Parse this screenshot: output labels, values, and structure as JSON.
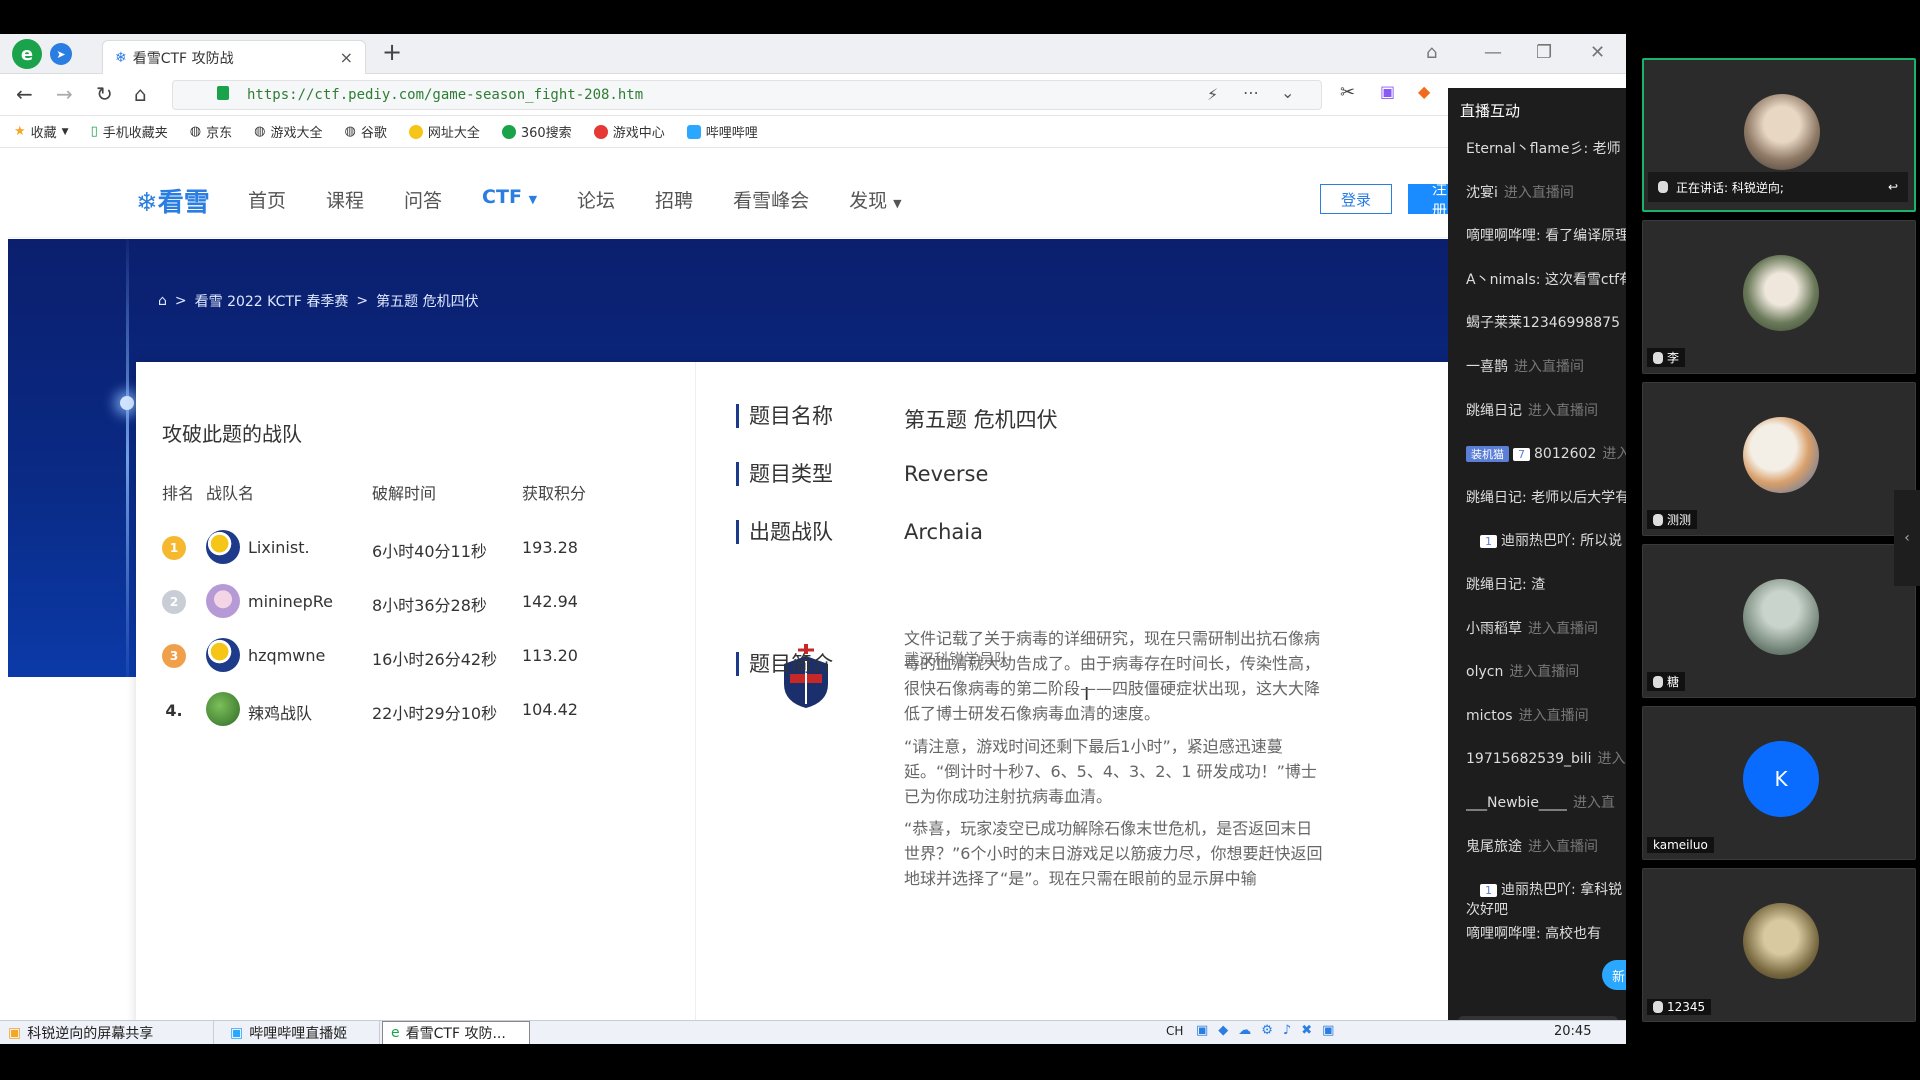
{
  "browser": {
    "tab_title": "看雪CTF 攻防战",
    "tab_close": "×",
    "new_tab": "+",
    "url": "https://ctf.pediy.com/game-season_fight-208.htm",
    "bookmarks": [
      "收藏",
      "手机收藏夹",
      "京东",
      "游戏大全",
      "谷歌",
      "网址大全",
      "360搜索",
      "游戏中心",
      "哔哩哔哩"
    ]
  },
  "site": {
    "logo": "看雪",
    "nav": [
      "首页",
      "课程",
      "问答",
      "CTF",
      "论坛",
      "招聘",
      "看雪峰会",
      "发现"
    ],
    "login": "登录",
    "register": "注册"
  },
  "breadcrumb": {
    "sep": ">",
    "season": "看雪 2022 KCTF 春季赛",
    "challenge": "第五题 危机四伏"
  },
  "teams": {
    "title": "攻破此题的战队",
    "headers": {
      "rank": "排名",
      "name": "战队名",
      "time": "破解时间",
      "score": "获取积分"
    },
    "rows": [
      {
        "rank": "1",
        "name": "Lixinist.",
        "time": "6小时40分11秒",
        "score": "193.28"
      },
      {
        "rank": "2",
        "name": "mininepRe",
        "time": "8小时36分28秒",
        "score": "142.94"
      },
      {
        "rank": "3",
        "name": "hzqmwne",
        "time": "16小时26分42秒",
        "score": "113.20"
      },
      {
        "rank": "4.",
        "name": "辣鸡战队",
        "time": "22小时29分10秒",
        "score": "104.42"
      }
    ]
  },
  "challenge": {
    "name_label": "题目名称",
    "name_value": "第五题 危机四伏",
    "type_label": "题目类型",
    "type_value": "Reverse",
    "team_label": "出题战队",
    "team_value": "Archaia",
    "team_org": "武汉科锐学员队",
    "intro_label": "题目简介",
    "intro": [
      "文件记载了关于病毒的详细研究，现在只需研制出抗石像病毒的血清就大功告成了。由于病毒存在时间长，传染性高，很快石像病毒的第二阶段——四肢僵硬症状出现，这大大降低了博士研发石像病毒血清的速度。",
      "“请注意，游戏时间还剩下最后1小时”，紧迫感迅速蔓延。“倒计时十秒7、6、5、4、3、2、1 研发成功！”博士已为你成功注射抗病毒血清。",
      "“恭喜，玩家凌空已成功解除石像末世危机，是否返回末日世界？”6个小时的末日游戏足以筋疲力尽，你想要赶快返回地球并选择了“是”。现在只需在眼前的显示屏中输"
    ]
  },
  "live": {
    "title": "直播互动",
    "messages": [
      {
        "user": "Eternal丶flame彡: 老师",
        "note": ""
      },
      {
        "user": "沈宴i",
        "note": "进入直播间"
      },
      {
        "user": "嘀哩啊哗哩: 看了编译原理",
        "note": ""
      },
      {
        "user": "A丶nimals: 这次看雪ctf有",
        "note": ""
      },
      {
        "user": "蝎子莱莱12346998875",
        "note": ""
      },
      {
        "user": "一喜鹊",
        "note": "进入直播间"
      },
      {
        "user": "跳绳日记",
        "note": "进入直播间"
      },
      {
        "user": "8012602",
        "note": "进入",
        "badge": "装机猫",
        "badge_level": "7"
      },
      {
        "user": "跳绳日记: 老师以后大学有",
        "note": ""
      },
      {
        "user": "迪丽热巴吖: 所以说",
        "note": "",
        "badge": "",
        "badge_level": "1"
      },
      {
        "user": "跳绳日记: 渣",
        "note": ""
      },
      {
        "user": "小雨稻草",
        "note": "进入直播间"
      },
      {
        "user": "olycn",
        "note": "进入直播间"
      },
      {
        "user": "mictos",
        "note": "进入直播间"
      },
      {
        "user": "19715682539_bili",
        "note": "进入"
      },
      {
        "user": "___Newbie____",
        "note": "进入直"
      },
      {
        "user": "鬼尾旅途",
        "note": "进入直播间"
      },
      {
        "user": "迪丽热巴吖: 拿科锐",
        "note": "",
        "badge": "",
        "badge_level": "1",
        "line2": "次好吧"
      },
      {
        "user": "嘀哩啊哗哩: 高校也有",
        "note": ""
      }
    ],
    "new_button": "新"
  },
  "taskbar": {
    "items": [
      "科锐逆向的屏幕共享",
      "哔哩哔哩直播姬",
      "看雪CTF 攻防..."
    ],
    "ime": "CH",
    "clock": "20:45"
  },
  "video_panel": {
    "speaking_label": "正在讲话: 科锐逆向;",
    "tiles": [
      {
        "name": "",
        "speaking": true
      },
      {
        "name": "李"
      },
      {
        "name": "测测"
      },
      {
        "name": "糖"
      },
      {
        "name": "kameiluo",
        "initial": "K"
      },
      {
        "name": "12345"
      }
    ]
  },
  "colors": {
    "accent": "#2a7de1",
    "hero_dark": "#0b1f6d",
    "hero_light": "#0b3aa8",
    "live_bg": "#1d1d1d",
    "speaking_border": "#1bb36a"
  }
}
